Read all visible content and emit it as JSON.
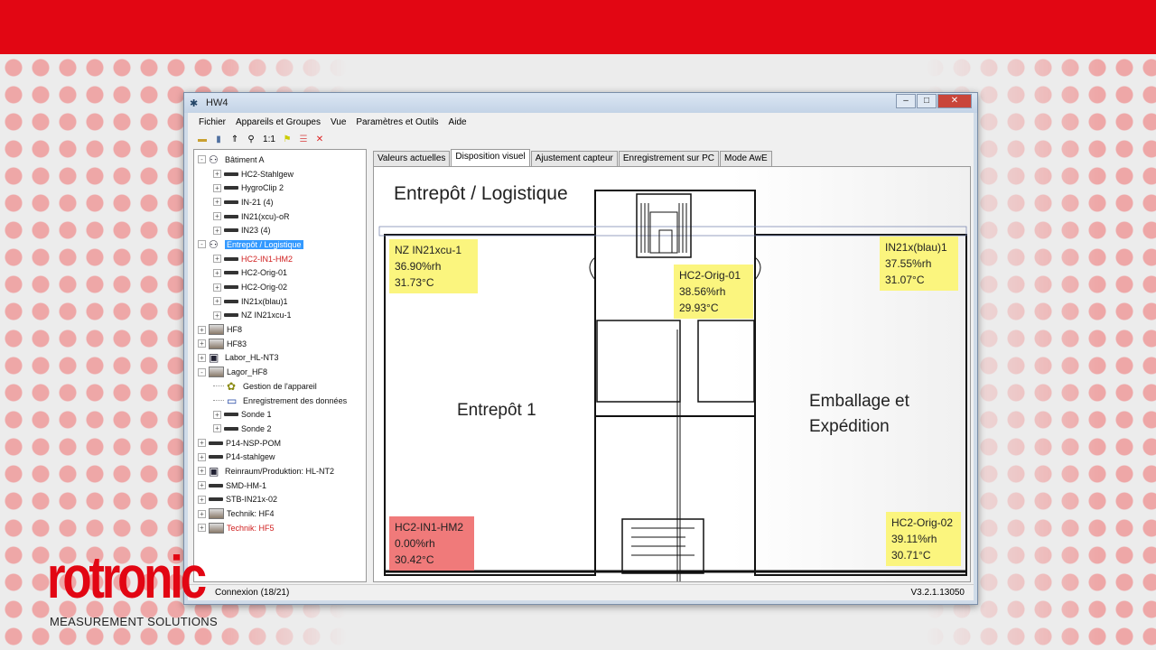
{
  "window": {
    "title": "HW4"
  },
  "menu": [
    "Fichier",
    "Appareils et Groupes",
    "Vue",
    "Paramètres et Outils",
    "Aide"
  ],
  "toolbar": {
    "ratio_label": "1:1"
  },
  "tree": [
    {
      "label": "Bâtiment A",
      "level": 0,
      "icon": "group",
      "exp": "-"
    },
    {
      "label": "HC2-Stahlgew",
      "level": 1,
      "icon": "probe",
      "exp": "+"
    },
    {
      "label": "HygroClip 2",
      "level": 1,
      "icon": "probe",
      "exp": "+"
    },
    {
      "label": "IN-21  (4)",
      "level": 1,
      "icon": "probe",
      "exp": "+"
    },
    {
      "label": "IN21(xcu)-oR",
      "level": 1,
      "icon": "probe",
      "exp": "+"
    },
    {
      "label": "IN23 (4)",
      "level": 1,
      "icon": "probe",
      "exp": "+"
    },
    {
      "label": "Entrepôt / Logistique",
      "level": 0,
      "icon": "group",
      "exp": "-",
      "state": "selected"
    },
    {
      "label": "HC2-IN1-HM2",
      "level": 1,
      "icon": "probe",
      "exp": "+",
      "state": "alarm"
    },
    {
      "label": "HC2-Orig-01",
      "level": 1,
      "icon": "probe",
      "exp": "+"
    },
    {
      "label": "HC2-Orig-02",
      "level": 1,
      "icon": "probe",
      "exp": "+"
    },
    {
      "label": "IN21x(blau)1",
      "level": 1,
      "icon": "probe",
      "exp": "+"
    },
    {
      "label": "NZ IN21xcu-1",
      "level": 1,
      "icon": "probe",
      "exp": "+"
    },
    {
      "label": "HF8",
      "level": 0,
      "icon": "box",
      "exp": "+"
    },
    {
      "label": "HF83",
      "level": 0,
      "icon": "box",
      "exp": "+"
    },
    {
      "label": "Labor_HL-NT3",
      "level": 0,
      "icon": "logger",
      "exp": "+"
    },
    {
      "label": "Lagor_HF8",
      "level": 0,
      "icon": "box",
      "exp": "-"
    },
    {
      "label": "Gestion de l'appareil",
      "level": 1,
      "icon": "gear",
      "exp": ""
    },
    {
      "label": "Enregistrement des données",
      "level": 1,
      "icon": "save",
      "exp": ""
    },
    {
      "label": "Sonde 1",
      "level": 1,
      "icon": "probe",
      "exp": "+"
    },
    {
      "label": "Sonde 2",
      "level": 1,
      "icon": "probe",
      "exp": "+"
    },
    {
      "label": "P14-NSP-POM",
      "level": 0,
      "icon": "probe",
      "exp": "+"
    },
    {
      "label": "P14-stahlgew",
      "level": 0,
      "icon": "probe",
      "exp": "+"
    },
    {
      "label": "Reinraum/Produktion: HL-NT2",
      "level": 0,
      "icon": "logger",
      "exp": "+"
    },
    {
      "label": "SMD-HM-1",
      "level": 0,
      "icon": "probe",
      "exp": "+"
    },
    {
      "label": "STB-IN21x-02",
      "level": 0,
      "icon": "probe",
      "exp": "+"
    },
    {
      "label": "Technik: HF4",
      "level": 0,
      "icon": "box",
      "exp": "+"
    },
    {
      "label": "Technik: HF5",
      "level": 0,
      "icon": "box",
      "exp": "+",
      "state": "alarm"
    }
  ],
  "tabs": [
    "Valeurs actuelles",
    "Disposition visuel",
    "Ajustement capteur",
    "Enregistrement sur PC",
    "Mode AwE"
  ],
  "active_tab": 1,
  "plan": {
    "title": "Entrepôt / Logistique",
    "room_left": "Entrepôt 1",
    "room_right_1": "Emballage et",
    "room_right_2": "Expédition",
    "sensors": [
      {
        "name": "NZ IN21xcu-1",
        "rh": "36.90%rh",
        "temp": "31.73°C",
        "state": "ok"
      },
      {
        "name": "HC2-Orig-01",
        "rh": "38.56%rh",
        "temp": "29.93°C",
        "state": "ok"
      },
      {
        "name": "IN21x(blau)1",
        "rh": "37.55%rh",
        "temp": "31.07°C",
        "state": "ok"
      },
      {
        "name": "HC2-IN1-HM2",
        "rh": "0.00%rh",
        "temp": "30.42°C",
        "state": "alarm"
      },
      {
        "name": "HC2-Orig-02",
        "rh": "39.11%rh",
        "temp": "30.71°C",
        "state": "ok"
      }
    ]
  },
  "status": {
    "text": "Connexion (18/21)",
    "version": "V3.2.1.13050"
  },
  "brand": {
    "logo": "rotronic",
    "tagline": "MEASUREMENT SOLUTIONS"
  },
  "colors": {
    "brand_red": "#e20613",
    "sensor_ok": "#fbf57e",
    "sensor_alarm": "#f07a7a",
    "selection": "#3399ff"
  }
}
